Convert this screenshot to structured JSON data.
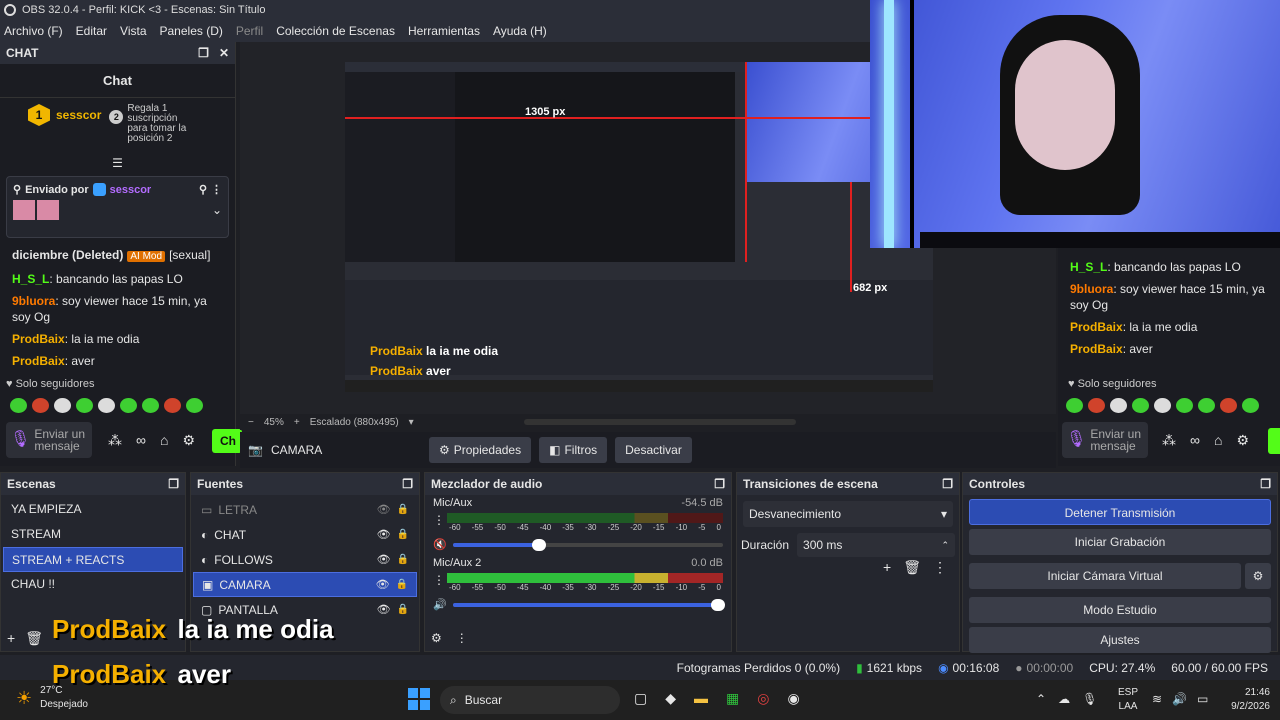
{
  "window": {
    "title": "OBS 32.0.4 - Perfil: KICK <3 - Escenas: Sin Título"
  },
  "menu": [
    "Archivo (F)",
    "Editar",
    "Vista",
    "Paneles (D)",
    "Perfil",
    "Colección de Escenas",
    "Herramientas",
    "Ayuda (H)"
  ],
  "chat": {
    "dock_title": "CHAT",
    "header": "Chat",
    "gift_user": "sesscor",
    "gift_rank": "1",
    "gift_rank2": "2",
    "gift_text": "Regala 1 suscripción para tomar la posición 2",
    "pinned_label": "Enviado por",
    "pinned_user": "sesscor",
    "messages": [
      {
        "user": "diciembre (Deleted)",
        "badge": "AI Mod",
        "text": "[sexual]",
        "color": "#e6e6e6"
      },
      {
        "user": "H_S_L",
        "text": "bancando las papas LO",
        "color": "#53fc18"
      },
      {
        "user": "9bluora",
        "text": "soy viewer hace 15 min, ya soy Og",
        "color": "#ff7a00"
      },
      {
        "user": "ProdBaix",
        "text": "la ia me odia",
        "color": "#f5b000"
      },
      {
        "user": "ProdBaix",
        "text": "aver",
        "color": "#f5b000"
      }
    ],
    "followers_only": "Solo seguidores",
    "send_placeholder": "Enviar un mensaje",
    "chat_button": "Ch"
  },
  "right_chat": {
    "messages": [
      {
        "user": "H_S_L",
        "text": "bancando las papas LO",
        "color": "#53fc18"
      },
      {
        "user": "9bluora",
        "text": "soy viewer hace 15 min, ya soy Og",
        "color": "#ff7a00"
      },
      {
        "user": "ProdBaix",
        "text": "la ia me odia",
        "color": "#f5b000"
      },
      {
        "user": "ProdBaix",
        "text": "aver",
        "color": "#f5b000"
      }
    ],
    "followers_only": "Solo seguidores",
    "send_placeholder": "Enviar un mensaje"
  },
  "preview": {
    "measure_w": "1305 px",
    "measure_h": "682 px",
    "overlay_user": "ProdBaix",
    "overlay_msg1": "la ia me odia",
    "overlay_msg2": "aver",
    "zoom": "45%",
    "scale_label": "Escalado (880x495)"
  },
  "source_toolbar": {
    "source": "CAMARA",
    "properties": "Propiedades",
    "filters": "Filtros",
    "deactivate": "Desactivar"
  },
  "scenes": {
    "title": "Escenas",
    "items": [
      "YA EMPIEZA",
      "STREAM",
      "STREAM + REACTS",
      "CHAU !!"
    ],
    "selected": 2
  },
  "sources": {
    "title": "Fuentes",
    "items": [
      {
        "name": "LETRA",
        "icon": "text-icon"
      },
      {
        "name": "CHAT",
        "icon": "browser-icon"
      },
      {
        "name": "FOLLOWS",
        "icon": "browser-icon"
      },
      {
        "name": "CAMARA",
        "icon": "camera-icon"
      },
      {
        "name": "PANTALLA",
        "icon": "monitor-icon"
      }
    ],
    "selected": 3
  },
  "mixer": {
    "title": "Mezclador de audio",
    "channels": [
      {
        "name": "Mic/Aux",
        "db": "-54.5 dB",
        "muted": true,
        "volume": 0.32
      },
      {
        "name": "Mic/Aux 2",
        "db": "0.0 dB",
        "muted": false,
        "volume": 0.98
      }
    ],
    "ticks": [
      "-60",
      "-55",
      "-50",
      "-45",
      "-40",
      "-35",
      "-30",
      "-25",
      "-20",
      "-15",
      "-10",
      "-5",
      "0"
    ]
  },
  "transitions": {
    "title": "Transiciones de escena",
    "selected": "Desvanecimiento",
    "duration_label": "Duración",
    "duration_value": "300 ms"
  },
  "controls": {
    "title": "Controles",
    "buttons": [
      "Detener Transmisión",
      "Iniciar Grabación",
      "Iniciar Cámara Virtual",
      "Modo Estudio",
      "Ajustes"
    ]
  },
  "overlay": {
    "user": "ProdBaix",
    "msg1": "la ia me odia",
    "msg2": "aver"
  },
  "status": {
    "dropped": "Fotogramas Perdidos 0 (0.0%)",
    "kbps": "1621 kbps",
    "stream_time": "00:16:08",
    "rec_time": "00:00:00",
    "cpu": "CPU: 27.4%",
    "fps": "60.00 / 60.00 FPS"
  },
  "taskbar": {
    "weather_temp": "27°C",
    "weather_desc": "Despejado",
    "search": "Buscar",
    "lang1": "ESP",
    "lang2": "LAA",
    "time": "21:46",
    "date": "9/2/2026"
  },
  "colors": {
    "accent": "#2c4cb3",
    "kick_green": "#53fc18",
    "overlay_gold": "#f5b000",
    "live_red": "#e02020"
  }
}
